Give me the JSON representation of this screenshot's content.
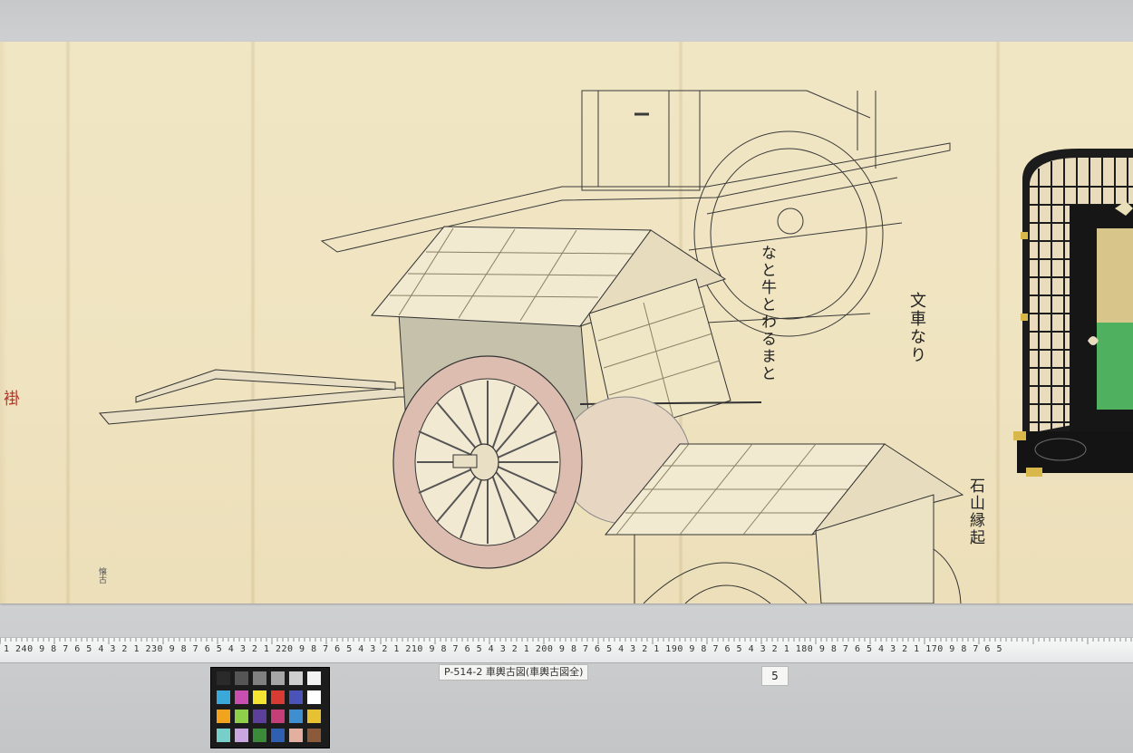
{
  "scroll": {
    "inscriptions": {
      "seal": "褂",
      "note_a": "なと牛とわるまと",
      "note_b": "文車なり",
      "note_c": "石山縁起",
      "margin_stamp": "懐古"
    }
  },
  "ruler": {
    "numbers": "1 240 9 8 7 6 5 4 3 2 1 230 9 8 7 6 5 4 3 2 1 220 9 8 7 6 5 4 3 2 1 210 9 8 7 6 5 4 3 2 1 200 9 8 7 6 5 4 3 2 1 190 9 8 7 6 5 4 3 2 1 180 9 8 7 6 5 4 3 2 1 170 9 8 7 6 5",
    "highlight_color": "#c8353a"
  },
  "label_card": {
    "text": "P-514-2 車輿古図(車輿古図全)"
  },
  "page_card": {
    "text": "5"
  },
  "color_chart": {
    "swatches": [
      "#2a2a2a",
      "#555555",
      "#808080",
      "#a6a6a6",
      "#cfcfcf",
      "#f2f2f2",
      "#3aa8d8",
      "#c84fb0",
      "#f3e433",
      "#d83a34",
      "#4a54b8",
      "#ffffff",
      "#f2a31d",
      "#8ed04a",
      "#5b3f98",
      "#c43f78",
      "#3f8fd0",
      "#e6c233",
      "#76cfc8",
      "#c9a6e0",
      "#3a8a3a",
      "#2e5fb0",
      "#e3b0a0",
      "#8a5a3a"
    ]
  },
  "colors": {
    "paper": "#efe3c0",
    "wheel_pink": "#dcbdb0",
    "roof_cream": "#f1ead0",
    "lacquer_black": "#1a1a1a",
    "gold": "#d8b84a",
    "green_panel": "#4fb060"
  }
}
